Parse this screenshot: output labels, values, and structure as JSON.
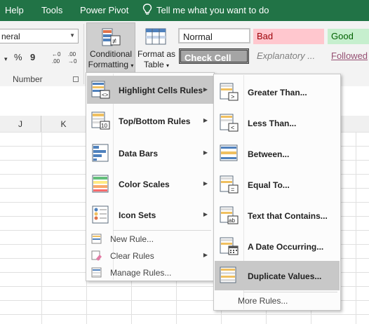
{
  "ribbon_tabs": [
    "Help",
    "Tools",
    "Power Pivot"
  ],
  "tell_me": "Tell me what you want to do",
  "number_group": {
    "format_value": "neral",
    "currency_glyph": "$",
    "percent_glyph": "%",
    "comma_glyph": "9",
    "inc_decimal": ".00",
    "dec_decimal": ".00",
    "label": "Number"
  },
  "conditional_formatting": {
    "line1": "Conditional",
    "line2": "Formatting"
  },
  "format_as_table": {
    "line1": "Format as",
    "line2": "Table"
  },
  "cell_styles": {
    "normal": "Normal",
    "bad": "Bad",
    "good": "Good",
    "check_cell": "Check Cell",
    "explanatory": "Explanatory ...",
    "followed": "Followed"
  },
  "columns": [
    "J",
    "K"
  ],
  "main_menu": {
    "items": [
      {
        "label": "Highlight Cells Rules"
      },
      {
        "label": "Top/Bottom Rules"
      },
      {
        "label": "Data Bars"
      },
      {
        "label": "Color Scales"
      },
      {
        "label": "Icon Sets"
      }
    ],
    "small_items": [
      {
        "label": "New Rule..."
      },
      {
        "label": "Clear Rules"
      },
      {
        "label": "Manage Rules..."
      }
    ]
  },
  "submenu": {
    "items": [
      {
        "label": "Greater Than..."
      },
      {
        "label": "Less Than..."
      },
      {
        "label": "Between..."
      },
      {
        "label": "Equal To..."
      },
      {
        "label": "Text that Contains..."
      },
      {
        "label": "A Date Occurring..."
      },
      {
        "label": "Duplicate Values..."
      }
    ],
    "more": "More Rules..."
  },
  "colors": {
    "ribbon_accent": "#217346",
    "menu_highlight": "#c8c8c8",
    "bad_fill": "#ffc7ce",
    "bad_text": "#9c0006",
    "good_fill": "#c6efce",
    "good_text": "#006100",
    "check_fill": "#a5a5a5",
    "followed_text": "#954f72"
  },
  "icons": {
    "tell_me": "lightbulb-icon",
    "conditional_formatting": "conditional-formatting-icon",
    "format_as_table": "table-icon",
    "highlight_cells": "highlight-cells-icon",
    "top_bottom": "top-bottom-icon",
    "data_bars": "data-bars-icon",
    "color_scales": "color-scales-icon",
    "icon_sets": "icon-sets-icon",
    "new_rule": "new-rule-icon",
    "clear_rules": "clear-rules-icon",
    "manage_rules": "manage-rules-icon"
  }
}
